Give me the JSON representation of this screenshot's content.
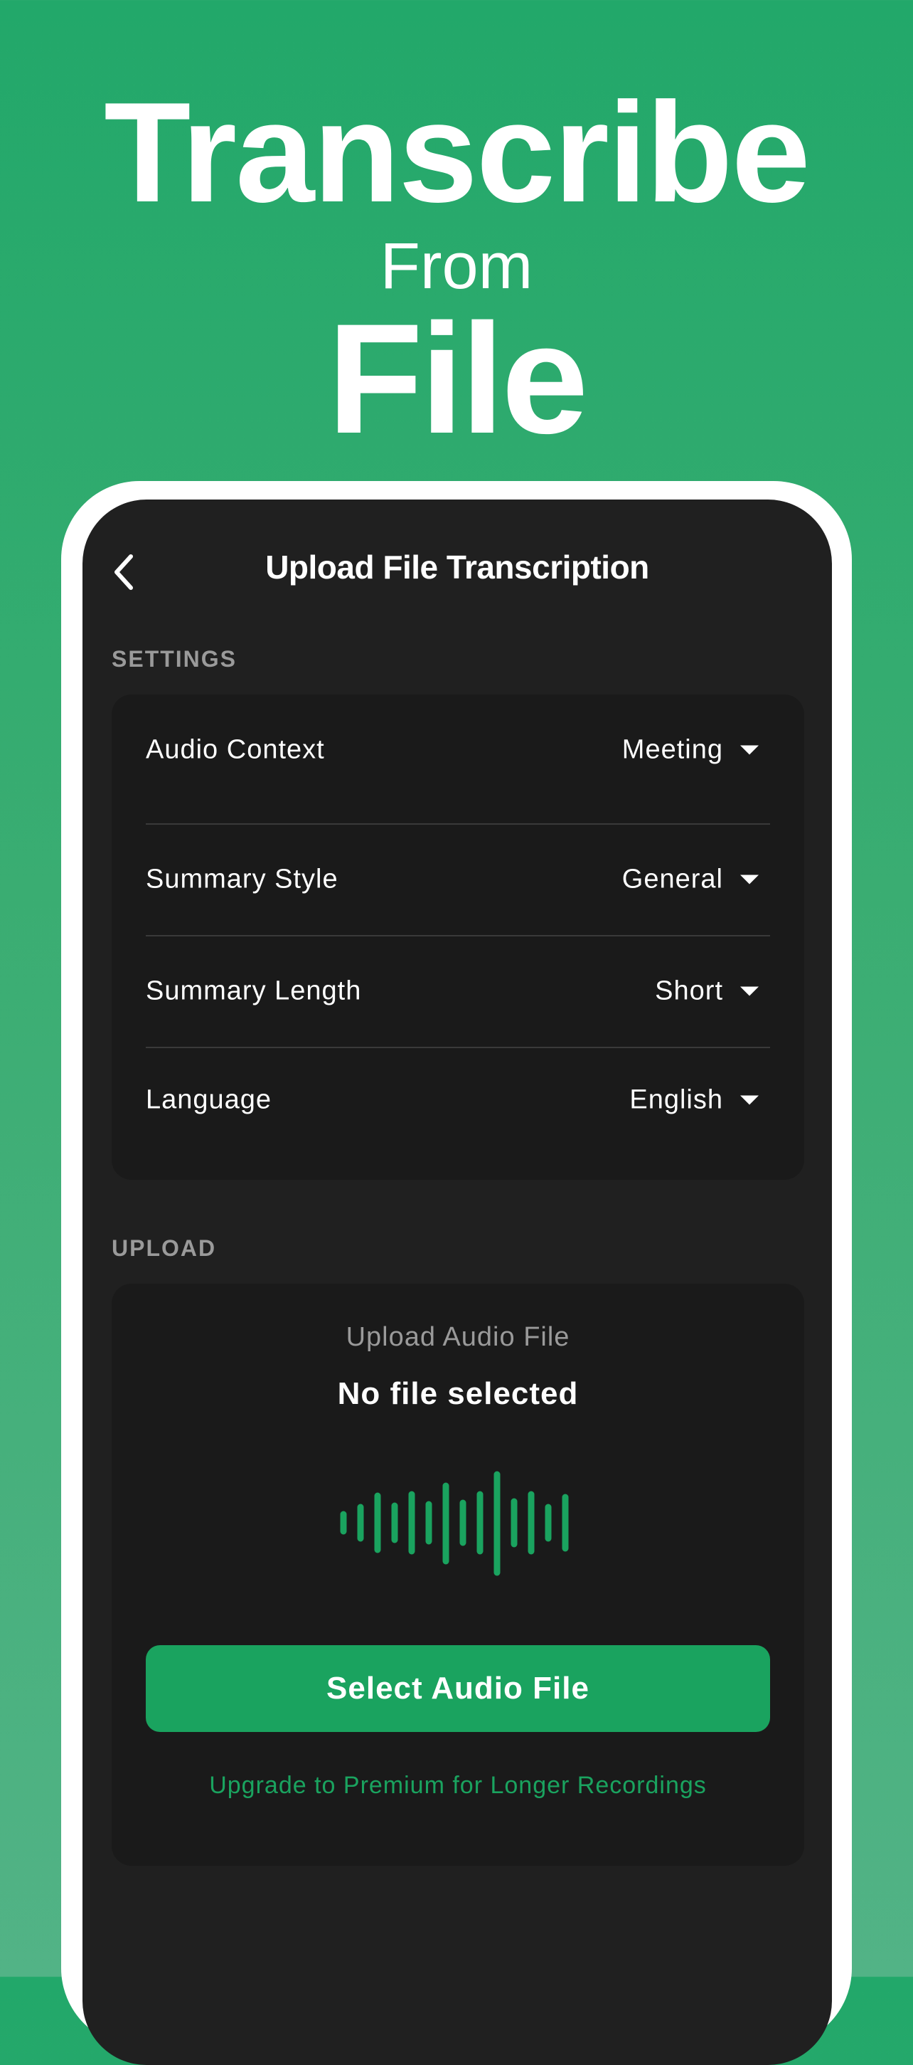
{
  "hero": {
    "line1": "Transcribe",
    "line2": "From",
    "line3": "File"
  },
  "nav": {
    "back_icon": "chevron-left-icon",
    "title": "Upload File Transcription"
  },
  "settings": {
    "section_label": "SETTINGS",
    "rows": [
      {
        "label": "Audio Context",
        "value": "Meeting"
      },
      {
        "label": "Summary Style",
        "value": "General"
      },
      {
        "label": "Summary Length",
        "value": "Short"
      },
      {
        "label": "Language",
        "value": "English"
      }
    ]
  },
  "upload": {
    "section_label": "UPLOAD",
    "subtitle": "Upload Audio File",
    "status": "No file selected",
    "waveform_icon": "waveform-icon",
    "button_label": "Select Audio File",
    "upgrade_text": "Upgrade to Premium for Longer Recordings"
  },
  "colors": {
    "accent": "#1aa35f",
    "background_top": "#22a86a",
    "screen_bg": "#202020",
    "card_bg": "#1a1a1a"
  }
}
